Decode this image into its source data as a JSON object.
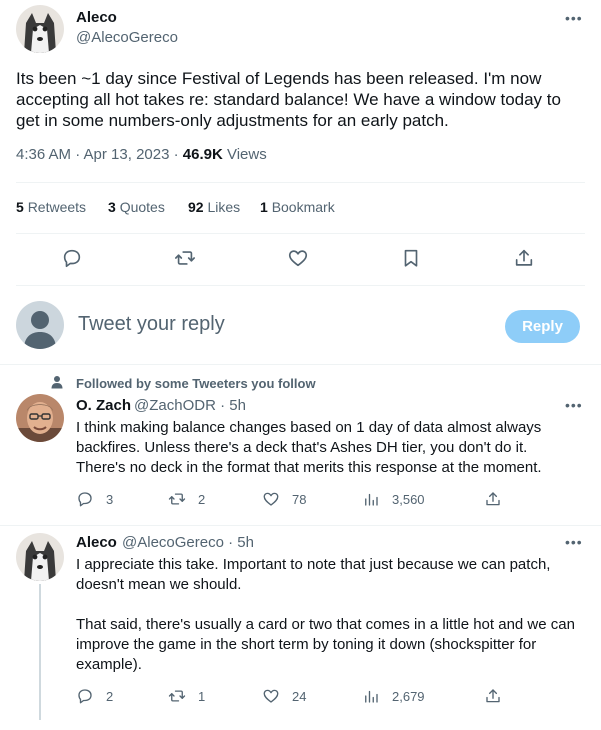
{
  "tweet": {
    "author_name": "Aleco",
    "author_handle": "@AlecoGereco",
    "text": "Its been ~1 day since Festival of Legends has been released. I'm now accepting all hot takes re: standard balance! We have a window today to get in some numbers-only adjustments for an early patch.",
    "time": "4:36 AM · Apr 13, 2023 · ",
    "views_count": "46.9K",
    "views_label": " Views",
    "retweets": "5",
    "retweets_label": "Retweets",
    "quotes": "3",
    "quotes_label": "Quotes",
    "likes": "92",
    "likes_label": "Likes",
    "bookmarks": "1",
    "bookmarks_label": "Bookmark"
  },
  "reply_box": {
    "placeholder": "Tweet your reply",
    "button": "Reply"
  },
  "social_context": "Followed by some Tweeters you follow",
  "replies": [
    {
      "name": "O. Zach",
      "handle": "@ZachODR · 5h",
      "text": "I think making balance changes based on 1 day of data almost always backfires. Unless there's a deck that's Ashes DH tier, you don't do it. There's no deck in the format that merits this response at the moment.",
      "replies": "3",
      "retweets": "2",
      "likes": "78",
      "views": "3,560"
    },
    {
      "name": "Aleco",
      "handle": "@AlecoGereco · 5h",
      "text_p1": "I appreciate this take. Important to note that just because we can patch, doesn't mean we should.",
      "text_p2": "That said, there's usually a card or two that comes in a little hot and we can improve the game in the short term by toning it down (shockspitter for example).",
      "replies": "2",
      "retweets": "1",
      "likes": "24",
      "views": "2,679"
    }
  ],
  "colors": {
    "accent": "#1d9bf0",
    "reply_button_disabled": "#8ecdf8",
    "secondary_text": "#536471"
  }
}
